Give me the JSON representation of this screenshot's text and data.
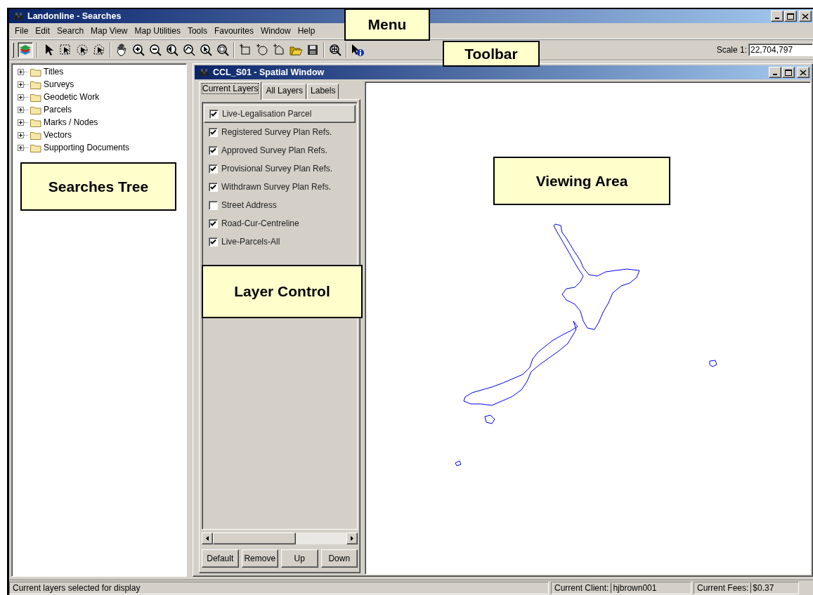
{
  "window": {
    "title": "Landonline - Searches"
  },
  "menu": [
    "File",
    "Edit",
    "Search",
    "Map View",
    "Map Utilities",
    "Tools",
    "Favourites",
    "Window",
    "Help"
  ],
  "toolbar": {
    "scale_label": "Scale 1:",
    "scale_value": "22,704,797"
  },
  "searches_tree": [
    {
      "label": "Titles",
      "expanded": false
    },
    {
      "label": "Surveys",
      "expanded": false
    },
    {
      "label": "Geodetic Work",
      "expanded": false
    },
    {
      "label": "Parcels",
      "expanded": false
    },
    {
      "label": "Marks / Nodes",
      "expanded": false
    },
    {
      "label": "Vectors",
      "expanded": false
    },
    {
      "label": "Supporting Documents",
      "expanded": false
    }
  ],
  "spatial_window": {
    "title": "CCL_S01 - Spatial Window",
    "tabs": [
      {
        "label": "Current Layers",
        "selected": true
      },
      {
        "label": "All Layers",
        "selected": false
      },
      {
        "label": "Labels",
        "selected": false
      }
    ],
    "layers": [
      {
        "label": "Live-Legalisation Parcel",
        "checked": true,
        "selected": true
      },
      {
        "label": "Registered Survey Plan Refs.",
        "checked": true,
        "selected": false
      },
      {
        "label": "Approved Survey Plan Refs.",
        "checked": true,
        "selected": false
      },
      {
        "label": "Provisional Survey Plan Refs.",
        "checked": true,
        "selected": false
      },
      {
        "label": "Withdrawn Survey Plan Refs.",
        "checked": true,
        "selected": false
      },
      {
        "label": "Street Address",
        "checked": false,
        "selected": false
      },
      {
        "label": "Road-Cur-Centreline",
        "checked": true,
        "selected": false
      },
      {
        "label": "Live-Parcels-All",
        "checked": true,
        "selected": false
      }
    ],
    "buttons": [
      "Default",
      "Remove",
      "Up",
      "Down"
    ]
  },
  "status_bar": {
    "message": "Current layers selected for display",
    "client_label": "Current Client:",
    "client_value": "hjbrown001",
    "fees_label": "Current Fees:",
    "fees_value": "$0.37"
  },
  "callouts": [
    {
      "text": "Menu"
    },
    {
      "text": "Toolbar"
    },
    {
      "text": "Viewing Area"
    },
    {
      "text": "Searches Tree"
    },
    {
      "text": "Layer Control"
    }
  ]
}
